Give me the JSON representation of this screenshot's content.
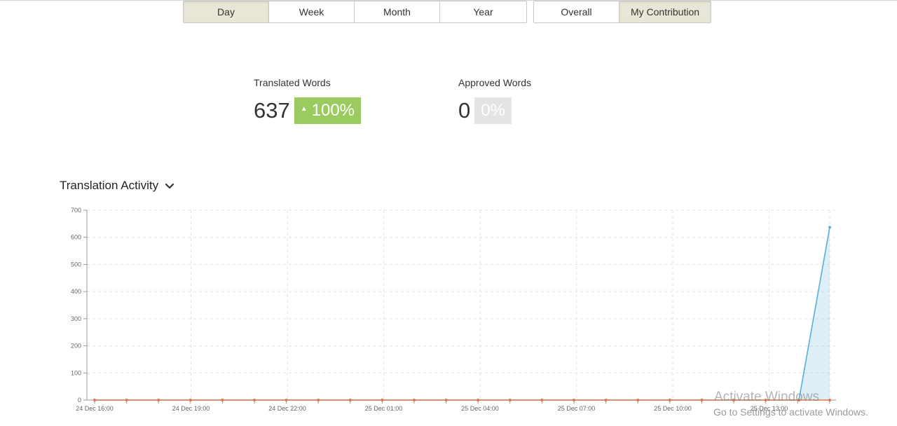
{
  "period_tabs": [
    "Day",
    "Week",
    "Month",
    "Year"
  ],
  "period_active": "Day",
  "scope_tabs": [
    "Overall",
    "My Contribution"
  ],
  "scope_active": "My Contribution",
  "stats": {
    "translated": {
      "label": "Translated Words",
      "value": "637",
      "change": "100%"
    },
    "approved": {
      "label": "Approved Words",
      "value": "0",
      "change": "0%"
    }
  },
  "activity": {
    "title": "Translation Activity",
    "icon": "chevron-down-icon"
  },
  "colors": {
    "accent_green": "#9bcb5f",
    "series_blue": "#5aaedb",
    "series_orange": "#e07a4d",
    "active_tab": "#e8e6d7"
  },
  "chart_data": {
    "type": "area",
    "x_labels": [
      "24 Dec 16:00",
      "24 Dec 19:00",
      "24 Dec 22:00",
      "25 Dec 01:00",
      "25 Dec 04:00",
      "25 Dec 07:00",
      "25 Dec 10:00",
      "25 Dec 13:00"
    ],
    "ylim": [
      0,
      700
    ],
    "yticks": [
      0,
      100,
      200,
      300,
      400,
      500,
      600,
      700
    ],
    "grid": true,
    "series": [
      {
        "values": [
          0,
          0,
          0,
          0,
          0,
          0,
          0,
          0,
          0,
          0,
          0,
          0,
          0,
          0,
          0,
          0,
          0,
          0,
          0,
          0,
          0,
          0,
          0,
          637
        ]
      },
      {
        "values": [
          0,
          0,
          0,
          0,
          0,
          0,
          0,
          0,
          0,
          0,
          0,
          0,
          0,
          0,
          0,
          0,
          0,
          0,
          0,
          0,
          0,
          0,
          0,
          0
        ]
      }
    ]
  },
  "watermark": {
    "line1": "Activate Windows",
    "line2": "Go to Settings to activate Windows."
  }
}
